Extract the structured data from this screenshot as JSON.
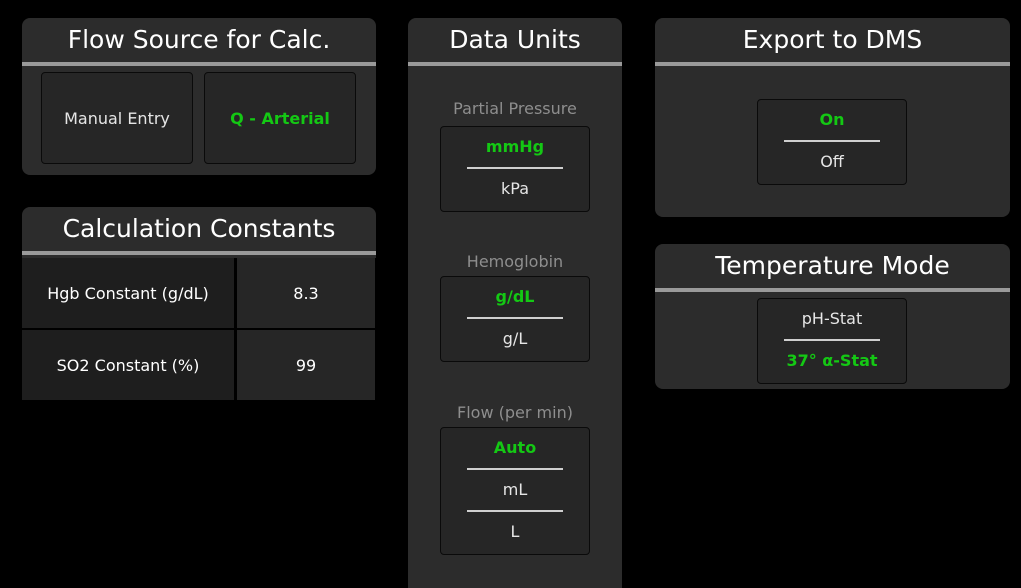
{
  "flow_source": {
    "title": "Flow Source for Calc.",
    "manual_entry": "Manual Entry",
    "q_arterial": "Q - Arterial"
  },
  "calc_constants": {
    "title": "Calculation Constants",
    "rows": [
      {
        "label": "Hgb Constant (g/dL)",
        "value": "8.3"
      },
      {
        "label": "SO2 Constant (%)",
        "value": "99"
      }
    ]
  },
  "data_units": {
    "title": "Data Units",
    "partial_pressure": {
      "label": "Partial Pressure",
      "options": [
        "mmHg",
        "kPa"
      ],
      "selected": "mmHg"
    },
    "hemoglobin": {
      "label": "Hemoglobin",
      "options": [
        "g/dL",
        "g/L"
      ],
      "selected": "g/dL"
    },
    "flow": {
      "label": "Flow (per min)",
      "options": [
        "Auto",
        "mL",
        "L"
      ],
      "selected": "Auto"
    }
  },
  "export_dms": {
    "title": "Export to DMS",
    "options": [
      "On",
      "Off"
    ],
    "selected": "On"
  },
  "temperature_mode": {
    "title": "Temperature Mode",
    "options": [
      "pH-Stat",
      "37° α-Stat"
    ],
    "selected": "37° α-Stat"
  },
  "colors": {
    "selected_text": "#14c814",
    "panel_bg": "#2c2c2c",
    "background": "#000000"
  }
}
